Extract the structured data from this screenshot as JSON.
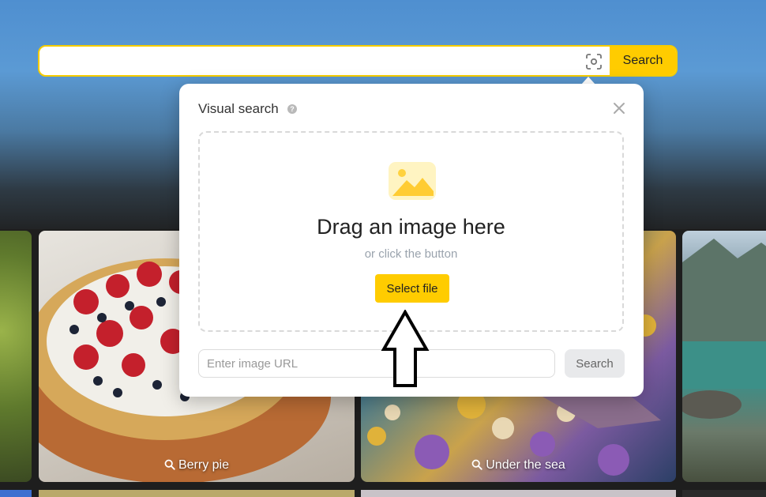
{
  "search": {
    "value": "",
    "button_label": "Search",
    "camera_icon": "camera-scan-icon",
    "accent_color": "#ffcc00"
  },
  "visual_search": {
    "title": "Visual search",
    "help_icon": "question-icon",
    "help_glyph": "?",
    "close_icon": "close-icon",
    "dropzone": {
      "icon": "image-placeholder-icon",
      "title": "Drag an image here",
      "subtitle": "or click the button",
      "select_button_label": "Select file"
    },
    "url_input": {
      "placeholder": "Enter image URL",
      "value": ""
    },
    "url_search_label": "Search"
  },
  "tiles": [
    {
      "name": "Berry pie",
      "icon": "search-icon"
    },
    {
      "name": "Under the sea",
      "icon": "search-icon"
    }
  ],
  "annotation": {
    "icon": "up-arrow-outline"
  }
}
